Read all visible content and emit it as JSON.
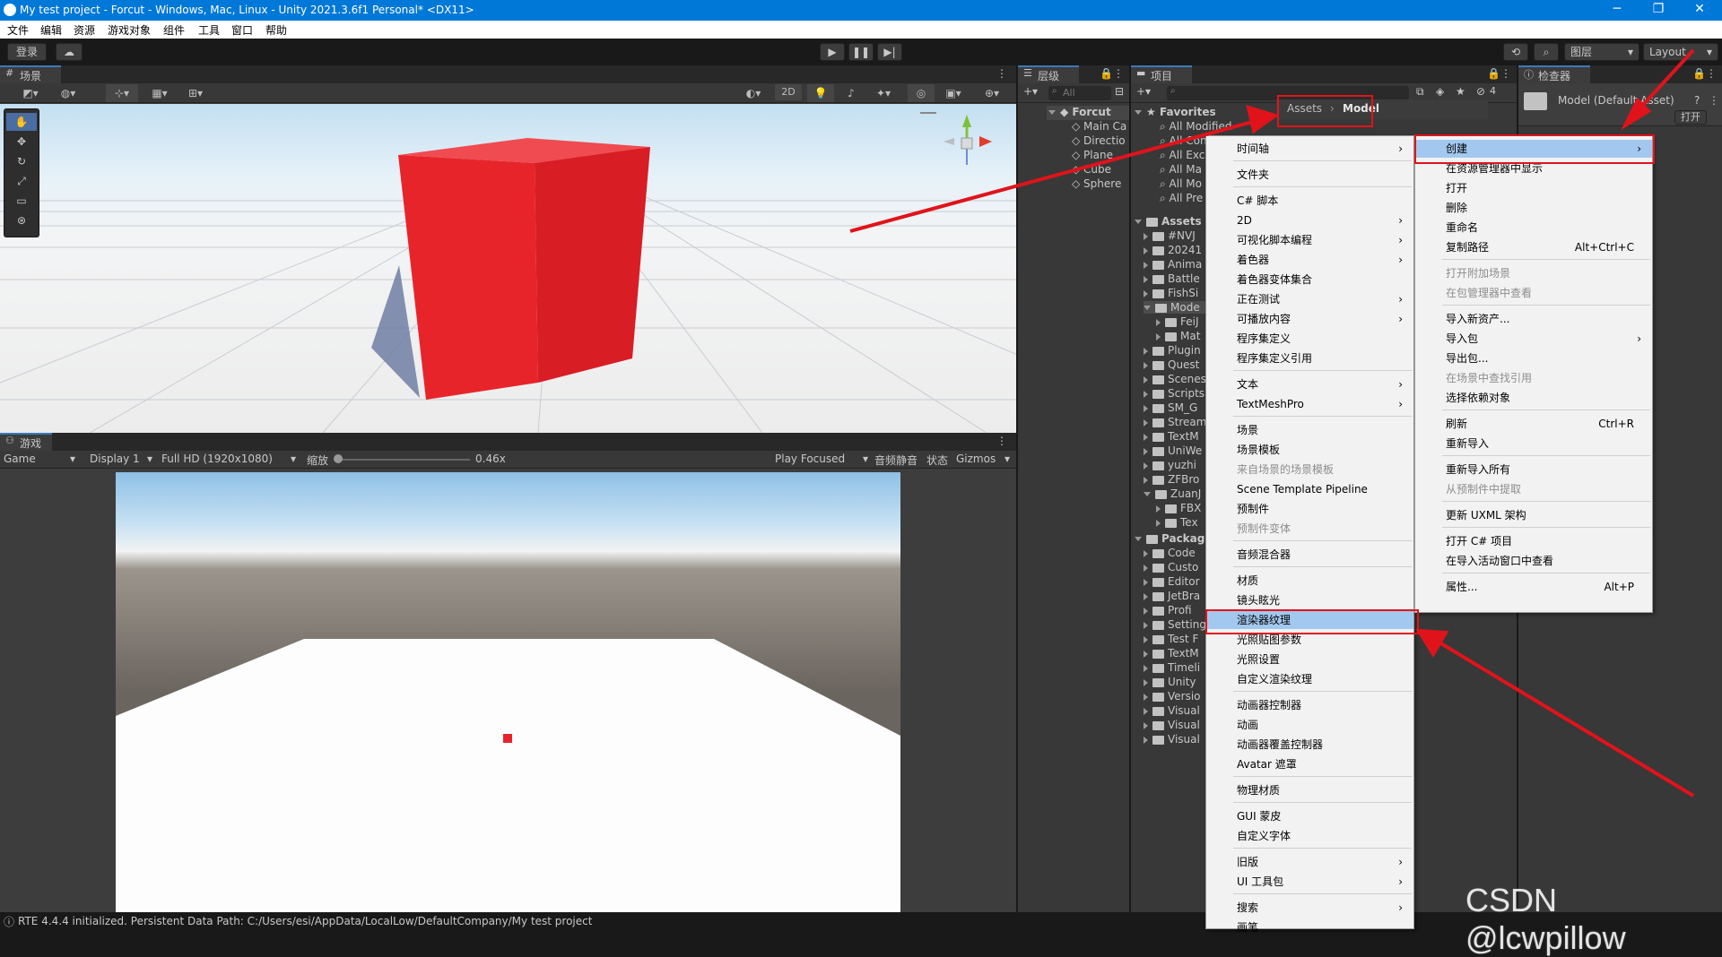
{
  "window": {
    "title": "My test project - Forcut - Windows, Mac, Linux - Unity 2021.3.6f1 Personal* <DX11>",
    "min": "─",
    "max": "❐",
    "close": "✕"
  },
  "menubar": [
    "文件",
    "编辑",
    "资源",
    "游戏对象",
    "组件",
    "工具",
    "窗口",
    "帮助"
  ],
  "toolbar": {
    "login": "登录",
    "layers": "图层",
    "layout": "Layout"
  },
  "scene": {
    "tab": "场景",
    "mode_2d": "2D"
  },
  "game": {
    "tab": "游戏",
    "display_type": "Game",
    "display": "Display 1",
    "resolution": "Full HD (1920x1080)",
    "scale_label": "缩放",
    "scale_value": "0.46x",
    "play_focused": "Play Focused",
    "mute": "音频静音",
    "stats": "状态",
    "gizmos": "Gizmos"
  },
  "hierarchy": {
    "tab": "层级",
    "search_placeholder": "All",
    "scene": "Forcut",
    "items": [
      "Main Ca",
      "Directio",
      "Plane",
      "Cube",
      "Sphere"
    ]
  },
  "project": {
    "tab": "项目",
    "breadcrumb": [
      "Assets",
      "Model"
    ],
    "count": "4",
    "favorites_label": "Favorites",
    "favorites": [
      "All Modified",
      "All Conflicts",
      "All Exc",
      "All Ma",
      "All Mo",
      "All Pre"
    ],
    "assets_label": "Assets",
    "assets": [
      "#NVJ",
      "20241",
      "Anima",
      "Battle",
      "FishSi",
      "Mode",
      "FeiJ",
      "Mat",
      "Plugin",
      "Quest",
      "Scenes",
      "Scripts",
      "SM_G",
      "Stream",
      "TextM",
      "UniWe",
      "yuzhi",
      "ZFBro",
      "ZuanJ",
      "FBX",
      "Tex"
    ],
    "packages_label": "Package",
    "packages": [
      "Code",
      "Custo",
      "Editor",
      "JetBra",
      "Profi",
      "Setting",
      "Test F",
      "TextM",
      "Timeli",
      "Unity",
      "Versio",
      "Visual",
      "Visual",
      "Visual"
    ]
  },
  "inspector": {
    "tab": "检查器",
    "asset": "Model (Default Asset)",
    "open": "打开"
  },
  "context_menu": [
    {
      "label": "创建",
      "arrow": true,
      "highlight": true
    },
    {
      "label": "在资源管理器中显示"
    },
    {
      "label": "打开"
    },
    {
      "label": "删除"
    },
    {
      "label": "重命名"
    },
    {
      "label": "复制路径",
      "shortcut": "Alt+Ctrl+C"
    },
    {
      "label": "打开附加场景",
      "disabled": true
    },
    {
      "label": "在包管理器中查看",
      "disabled": true
    },
    {
      "label": "导入新资产..."
    },
    {
      "label": "导入包",
      "arrow": true
    },
    {
      "label": "导出包..."
    },
    {
      "label": "在场景中查找引用",
      "disabled": true
    },
    {
      "label": "选择依赖对象"
    },
    {
      "label": "刷新",
      "shortcut": "Ctrl+R"
    },
    {
      "label": "重新导入"
    },
    {
      "label": "重新导入所有"
    },
    {
      "label": "从预制件中提取",
      "disabled": true
    },
    {
      "label": "更新 UXML 架构"
    },
    {
      "label": "打开 C# 项目"
    },
    {
      "label": "在导入活动窗口中查看"
    },
    {
      "label": "属性...",
      "shortcut": "Alt+P"
    }
  ],
  "create_submenu": [
    {
      "label": "时间轴",
      "arrow": true
    },
    {
      "label": "文件夹"
    },
    {
      "label": "C# 脚本"
    },
    {
      "label": "2D",
      "arrow": true
    },
    {
      "label": "可视化脚本编程",
      "arrow": true
    },
    {
      "label": "着色器",
      "arrow": true
    },
    {
      "label": "着色器变体集合"
    },
    {
      "label": "正在测试",
      "arrow": true
    },
    {
      "label": "可播放内容",
      "arrow": true
    },
    {
      "label": "程序集定义"
    },
    {
      "label": "程序集定义引用"
    },
    {
      "label": "文本",
      "arrow": true
    },
    {
      "label": "TextMeshPro",
      "arrow": true
    },
    {
      "label": "场景"
    },
    {
      "label": "场景模板"
    },
    {
      "label": "来自场景的场景模板",
      "disabled": true
    },
    {
      "label": "Scene Template Pipeline"
    },
    {
      "label": "预制件"
    },
    {
      "label": "预制件变体",
      "disabled": true
    },
    {
      "label": "音频混合器"
    },
    {
      "label": "材质"
    },
    {
      "label": "镜头眩光"
    },
    {
      "label": "渲染器纹理",
      "highlight": true
    },
    {
      "label": "光照贴图参数"
    },
    {
      "label": "光照设置"
    },
    {
      "label": "自定义渲染纹理"
    },
    {
      "label": "动画器控制器"
    },
    {
      "label": "动画"
    },
    {
      "label": "动画器覆盖控制器"
    },
    {
      "label": "Avatar 遮罩"
    },
    {
      "label": "物理材质"
    },
    {
      "label": "GUI 蒙皮"
    },
    {
      "label": "自定义字体"
    },
    {
      "label": "旧版",
      "arrow": true
    },
    {
      "label": "UI 工具包",
      "arrow": true
    },
    {
      "label": "搜索",
      "arrow": true
    },
    {
      "label": "画笔"
    }
  ],
  "status": {
    "text": "RTE 4.4.4 initialized. Persistent Data Path: C:/Users/esi/AppData/LocalLow/DefaultCompany/My test project"
  },
  "watermark": "CSDN @lcwpillow",
  "colors": {
    "annotation": "#e0131b",
    "cube": "#e8242b",
    "title_bar": "#0078d7"
  }
}
